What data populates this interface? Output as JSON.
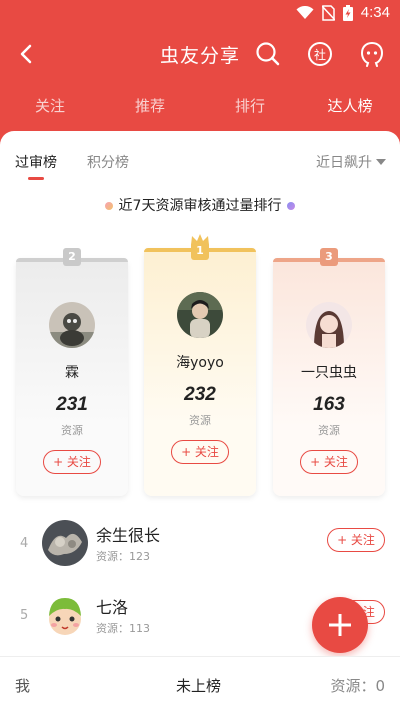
{
  "status": {
    "time": "4:34"
  },
  "header": {
    "title": "虫友分享"
  },
  "tabs": [
    {
      "label": "关注"
    },
    {
      "label": "推荐"
    },
    {
      "label": "排行"
    },
    {
      "label": "达人榜"
    }
  ],
  "subtabs": {
    "review": "过审榜",
    "points": "积分榜",
    "sort": "近日飙升"
  },
  "ranking": {
    "title": "近7天资源审核通过量排行"
  },
  "podium": [
    {
      "rank": "2",
      "name": "霖",
      "score": "231",
      "score_label": "资源",
      "follow": "+ 关注"
    },
    {
      "rank": "1",
      "name": "海yoyo",
      "score": "232",
      "score_label": "资源",
      "follow": "+ 关注"
    },
    {
      "rank": "3",
      "name": "一只虫虫",
      "score": "163",
      "score_label": "资源",
      "follow": "+ 关注"
    }
  ],
  "list": [
    {
      "rank": "4",
      "name": "余生很长",
      "resources": "资源：123",
      "follow": "+ 关注"
    },
    {
      "rank": "5",
      "name": "七洛",
      "resources": "资源：113",
      "follow": "+ 关注"
    }
  ],
  "bottom": {
    "me": "我",
    "rank_status": "未上榜",
    "resources": "资源：0"
  },
  "colors": {
    "accent": "#e84a43",
    "gold": "#f1c25c",
    "silver": "#c9c9c9",
    "bronze": "#eb9b7c"
  }
}
